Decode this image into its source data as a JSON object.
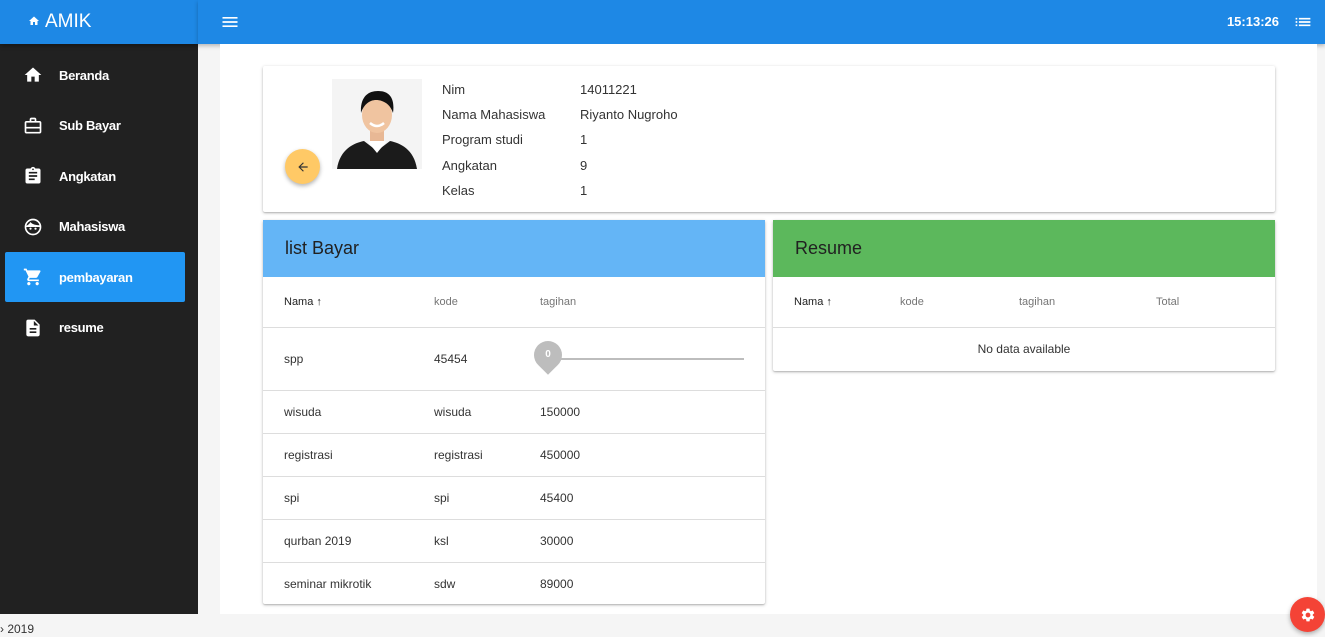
{
  "app": {
    "title": "AMIK"
  },
  "topbar": {
    "time": "15:13:26"
  },
  "sidebar": {
    "items": [
      {
        "label": "Beranda",
        "icon": "home-icon"
      },
      {
        "label": "Sub Bayar",
        "icon": "briefcase-icon"
      },
      {
        "label": "Angkatan",
        "icon": "clipboard-icon"
      },
      {
        "label": "Mahasiswa",
        "icon": "face-icon"
      },
      {
        "label": "pembayaran",
        "icon": "cart-icon",
        "active": true
      },
      {
        "label": "resume",
        "icon": "document-icon"
      }
    ]
  },
  "profile": {
    "fields": [
      {
        "label": "Nim",
        "value": "14011221"
      },
      {
        "label": "Nama Mahasiswa",
        "value": "Riyanto Nugroho"
      },
      {
        "label": "Program studi",
        "value": "1"
      },
      {
        "label": "Angkatan",
        "value": "9"
      },
      {
        "label": "Kelas",
        "value": "1"
      }
    ]
  },
  "list_bayar": {
    "title": "list Bayar",
    "headers": [
      "Nama",
      "kode",
      "tagihan"
    ],
    "rows": [
      {
        "nama": "spp",
        "kode": "45454",
        "tagihan": "",
        "slider_value": "0"
      },
      {
        "nama": "wisuda",
        "kode": "wisuda",
        "tagihan": "150000"
      },
      {
        "nama": "registrasi",
        "kode": "registrasi",
        "tagihan": "450000"
      },
      {
        "nama": "spi",
        "kode": "spi",
        "tagihan": "45400"
      },
      {
        "nama": "qurban 2019",
        "kode": "ksl",
        "tagihan": "30000"
      },
      {
        "nama": "seminar mikrotik",
        "kode": "sdw",
        "tagihan": "89000"
      }
    ]
  },
  "resume": {
    "title": "Resume",
    "headers": [
      "Nama",
      "kode",
      "tagihan",
      "Total"
    ],
    "empty_text": "No data available"
  },
  "footer": {
    "text": "› 2019"
  },
  "colors": {
    "primary": "#1e88e5",
    "active": "#2196f3",
    "list_head": "#64b5f6",
    "resume_head": "#5cb85c",
    "back_btn": "#ffc966",
    "fab": "#f44336"
  }
}
